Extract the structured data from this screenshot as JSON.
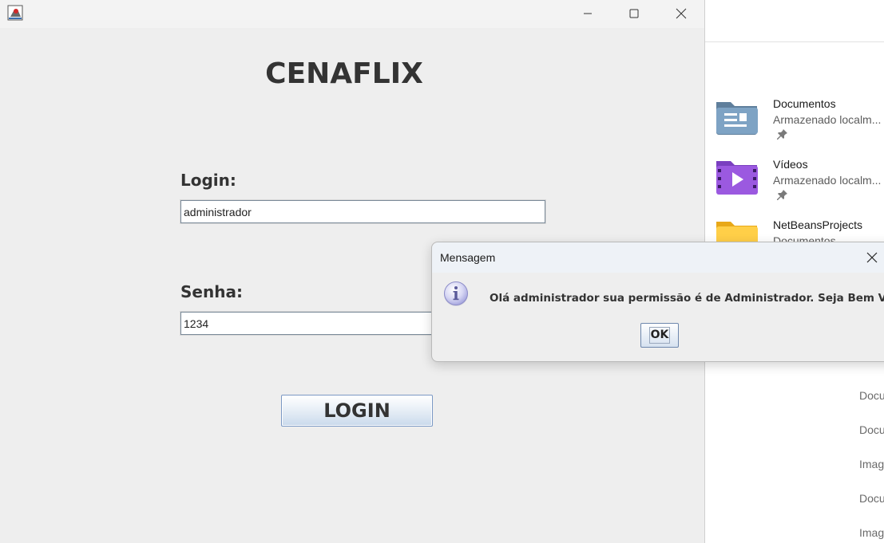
{
  "explorer": {
    "quick_access": [
      {
        "name": "Documentos",
        "sub": "Armazenado localm...",
        "icon": "documents-folder-icon",
        "pinned": true
      },
      {
        "name": "Vídeos",
        "sub": "Armazenado localm...",
        "icon": "videos-folder-icon",
        "pinned": true
      },
      {
        "name": "NetBeansProjects",
        "sub": "Documentos",
        "icon": "folder-icon",
        "pinned": false
      }
    ],
    "recent_locations": [
      "Docu",
      "Docu",
      "Imag",
      "Docu",
      "Imag"
    ]
  },
  "app": {
    "title": "CENAFLIX",
    "login_label": "Login:",
    "login_value": "administrador",
    "password_label": "Senha:",
    "password_value": "1234",
    "login_button": "LOGIN"
  },
  "dialog": {
    "title": "Mensagem",
    "message": "Olá administrador sua permissão é de Administrador. Seja Bem Vindo",
    "ok_button": "OK",
    "icon": "info-icon"
  },
  "colors": {
    "window_bg": "#eeeeee",
    "button_border": "#7a98c4",
    "text_dark": "#333333"
  }
}
